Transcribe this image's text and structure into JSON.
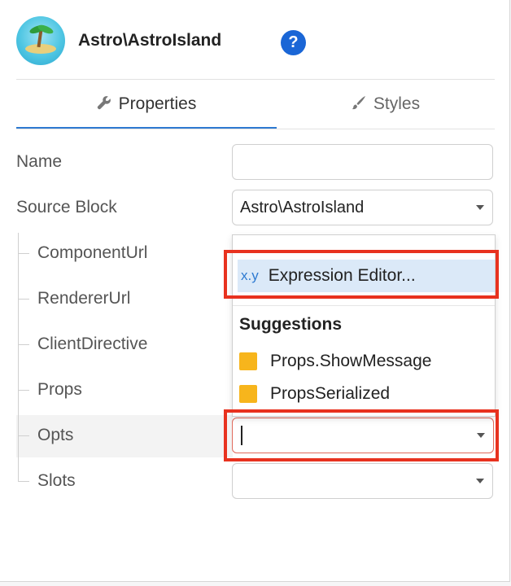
{
  "header": {
    "title": "Astro\\AstroIsland",
    "help_icon": "?"
  },
  "tabs": [
    {
      "label": "Properties",
      "icon": "wrench-icon",
      "active": true
    },
    {
      "label": "Styles",
      "icon": "brush-icon",
      "active": false
    }
  ],
  "fields": {
    "name": {
      "label": "Name",
      "value": ""
    },
    "source_block": {
      "label": "Source Block",
      "value": "Astro\\AstroIsland"
    }
  },
  "child_fields": [
    {
      "label": "ComponentUrl"
    },
    {
      "label": "RendererUrl"
    },
    {
      "label": "ClientDirective"
    },
    {
      "label": "Props"
    },
    {
      "label": "Opts"
    },
    {
      "label": "Slots"
    }
  ],
  "dropdown": {
    "expression_prefix": "x.y",
    "expression_label": "Expression Editor...",
    "suggestions_heading": "Suggestions",
    "suggestions": [
      "Props.ShowMessage",
      "PropsSerialized"
    ]
  },
  "colors": {
    "accent": "#2e7ad1",
    "highlight": "#dbe9f8",
    "annotation": "#e8321f",
    "suggestion_icon": "#f7b51c"
  }
}
